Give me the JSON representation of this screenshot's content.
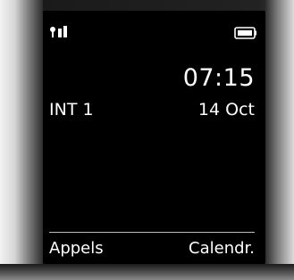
{
  "status_bar": {
    "signal_icon": "signal-strength-icon",
    "battery_icon": "battery-icon"
  },
  "idle_screen": {
    "time": "07:15",
    "handset_name": "INT 1",
    "date": "14 Oct"
  },
  "softkeys": {
    "left_label": "Appels",
    "right_label": "Calendr."
  }
}
